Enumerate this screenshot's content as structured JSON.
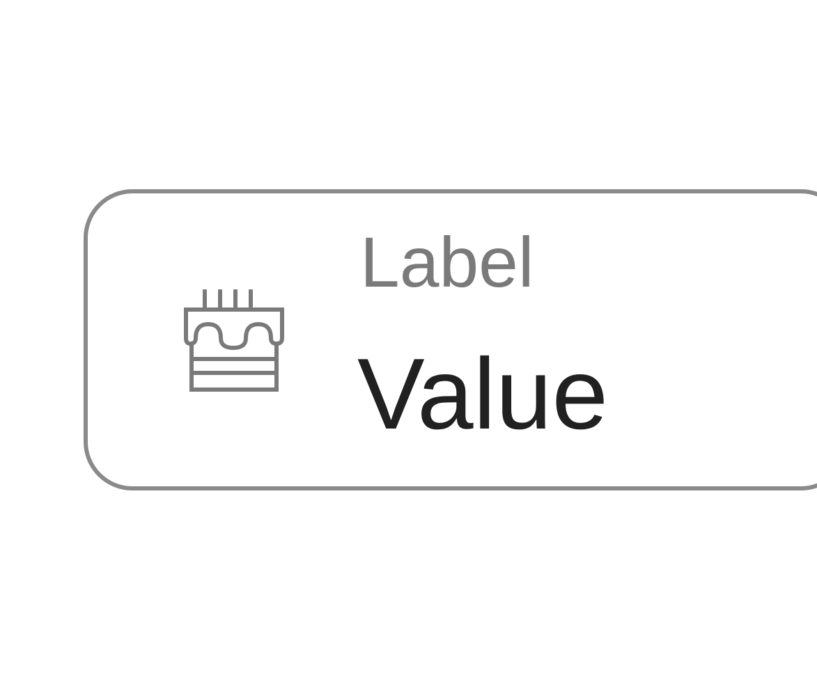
{
  "field": {
    "label": "Label",
    "value": "Value",
    "icon": "cake-icon"
  },
  "colors": {
    "border": "#8a8a8a",
    "label": "#7a7a7a",
    "value": "#212121",
    "icon": "#7a7a7a",
    "background": "#ffffff"
  }
}
